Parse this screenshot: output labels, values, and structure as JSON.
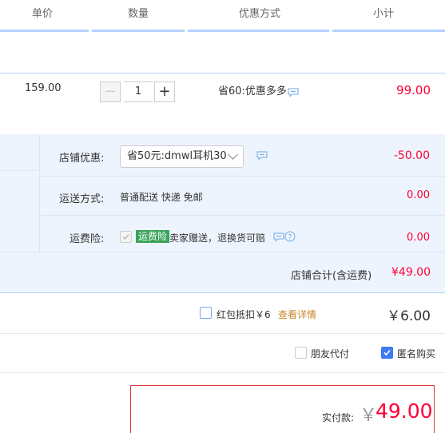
{
  "columns": {
    "unit_price": "单价",
    "quantity": "数量",
    "discount": "优惠方式",
    "subtotal": "小计"
  },
  "item": {
    "price": "159.00",
    "quantity": "1",
    "minus": "−",
    "plus": "+",
    "discount_text": "省60:优惠多多",
    "subtotal": "99.00"
  },
  "shop": {
    "coupon_label": "店铺优惠:",
    "coupon_selected": "省50元:dmwl耳机30",
    "coupon_value": "-50.00",
    "shipping_label": "运送方式:",
    "shipping_value": "普通配送 快递 免邮",
    "shipping_cost": "0.00",
    "insurance_label": "运费险:",
    "insurance_badge": "运费险",
    "insurance_text": "卖家赠送，退换货可赔",
    "insurance_cost": "0.00",
    "total_label": "店铺合计(含运费)",
    "total_value": "¥49.00"
  },
  "redpacket": {
    "label": "红包抵扣￥6",
    "link": "查看详情",
    "value": "￥6.00"
  },
  "options": {
    "friend_pay": "朋友代付",
    "anonymous": "匿名购买"
  },
  "payment": {
    "label": "实付款:",
    "currency": "￥",
    "amount": "49.00"
  },
  "colors": {
    "accent_red": "#ff0036",
    "link_orange": "#c8872b",
    "accent_blue": "#3d7bf5",
    "badge_green": "#3aa35a"
  }
}
